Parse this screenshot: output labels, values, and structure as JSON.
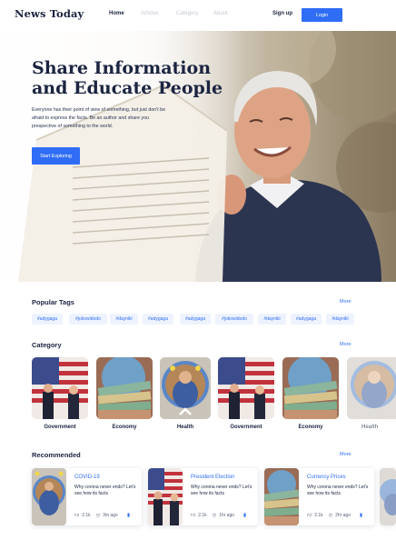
{
  "nav": {
    "logo": "News Today",
    "links": [
      "Home",
      "Articles",
      "Category",
      "About"
    ],
    "signup": "Sign up",
    "login": "Login"
  },
  "hero": {
    "title_line1": "Share Information",
    "title_line2": "and Educate People",
    "text": "Everyone has their point of view of something, but just don't be afraid to express the facts. Be an author and share you prespective of something to the world.",
    "button": "Start Exploring"
  },
  "tags": {
    "title": "Popular Tags",
    "more": "More",
    "items": [
      "#adygaga",
      "#jokowidodo",
      "#dayniki",
      "#adygaga",
      "#adygaga",
      "#jokowidodo",
      "#dayniki",
      "#adygaga",
      "#dayniki"
    ]
  },
  "category": {
    "title": "Category",
    "more": "More",
    "items": [
      "Government",
      "Economy",
      "Health",
      "Government",
      "Economy",
      "Health"
    ]
  },
  "recommended": {
    "title": "Recommended",
    "more": "More",
    "items": [
      {
        "title": "COVID-19",
        "desc": "Why corona never ends? Let's see how its facts",
        "likes": "2.1k",
        "time": "3m ago"
      },
      {
        "title": "President Election",
        "desc": "Why corona never ends? Let's see how its facts",
        "likes": "2.1k",
        "time": "1hr ago"
      },
      {
        "title": "Currency Prices",
        "desc": "Why corona never ends? Let's see how its facts",
        "likes": "2.1k",
        "time": "2hr ago"
      }
    ]
  },
  "colors": {
    "accent": "#2f6df6",
    "heading": "#1b2440",
    "tag_bg": "#eef3ff"
  },
  "icons": [
    "thumb-up-icon",
    "clock-icon",
    "bookmark-icon",
    "chevron-up-icon"
  ]
}
